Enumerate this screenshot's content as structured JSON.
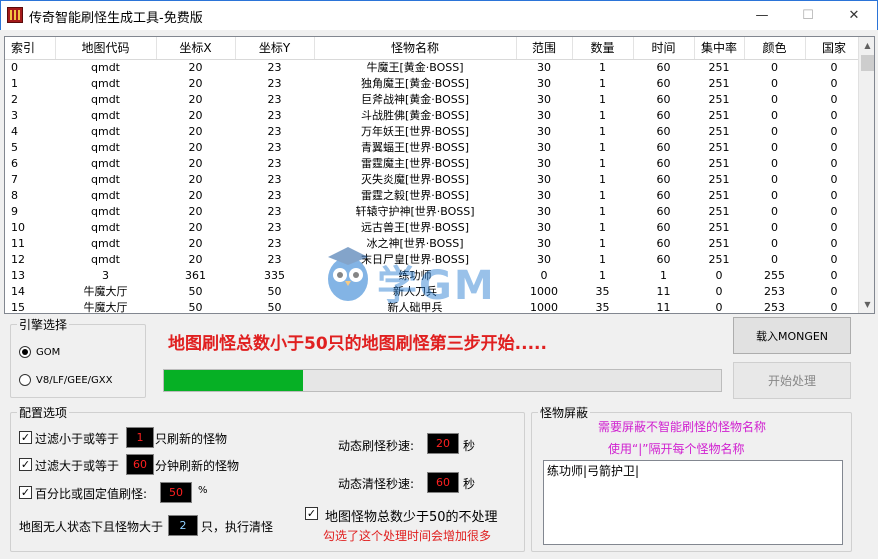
{
  "window": {
    "title": "传奇智能刷怪生成工具-免费版",
    "min": "—",
    "max": "☐",
    "close": "✕"
  },
  "grid": {
    "columns": [
      "索引",
      "地图代码",
      "坐标X",
      "坐标Y",
      "怪物名称",
      "范围",
      "数量",
      "时间",
      "集中率",
      "颜色",
      "国家"
    ],
    "rows": [
      [
        "0",
        "qmdt",
        "20",
        "23",
        "牛魔王[黄金·BOSS]",
        "30",
        "1",
        "60",
        "251",
        "0",
        "0"
      ],
      [
        "1",
        "qmdt",
        "20",
        "23",
        "独角魔王[黄金·BOSS]",
        "30",
        "1",
        "60",
        "251",
        "0",
        "0"
      ],
      [
        "2",
        "qmdt",
        "20",
        "23",
        "巨斧战神[黄金·BOSS]",
        "30",
        "1",
        "60",
        "251",
        "0",
        "0"
      ],
      [
        "3",
        "qmdt",
        "20",
        "23",
        "斗战胜佛[黄金·BOSS]",
        "30",
        "1",
        "60",
        "251",
        "0",
        "0"
      ],
      [
        "4",
        "qmdt",
        "20",
        "23",
        "万年妖王[世界·BOSS]",
        "30",
        "1",
        "60",
        "251",
        "0",
        "0"
      ],
      [
        "5",
        "qmdt",
        "20",
        "23",
        "青翼蝠王[世界·BOSS]",
        "30",
        "1",
        "60",
        "251",
        "0",
        "0"
      ],
      [
        "6",
        "qmdt",
        "20",
        "23",
        "雷霆魔主[世界·BOSS]",
        "30",
        "1",
        "60",
        "251",
        "0",
        "0"
      ],
      [
        "7",
        "qmdt",
        "20",
        "23",
        "灭失炎魔[世界·BOSS]",
        "30",
        "1",
        "60",
        "251",
        "0",
        "0"
      ],
      [
        "8",
        "qmdt",
        "20",
        "23",
        "雷霆之毅[世界·BOSS]",
        "30",
        "1",
        "60",
        "251",
        "0",
        "0"
      ],
      [
        "9",
        "qmdt",
        "20",
        "23",
        "轩辕守护神[世界·BOSS]",
        "30",
        "1",
        "60",
        "251",
        "0",
        "0"
      ],
      [
        "10",
        "qmdt",
        "20",
        "23",
        "远古兽王[世界·BOSS]",
        "30",
        "1",
        "60",
        "251",
        "0",
        "0"
      ],
      [
        "11",
        "qmdt",
        "20",
        "23",
        "冰之神[世界·BOSS]",
        "30",
        "1",
        "60",
        "251",
        "0",
        "0"
      ],
      [
        "12",
        "qmdt",
        "20",
        "23",
        "末日尸皇[世界·BOSS]",
        "30",
        "1",
        "60",
        "251",
        "0",
        "0"
      ],
      [
        "13",
        "3",
        "361",
        "335",
        "练功师",
        "0",
        "1",
        "1",
        "0",
        "255",
        "0"
      ],
      [
        "14",
        "牛魔大厅",
        "50",
        "50",
        "新人刀兵",
        "1000",
        "35",
        "11",
        "0",
        "253",
        "0"
      ],
      [
        "15",
        "牛魔大厅",
        "50",
        "50",
        "新人础甲兵",
        "1000",
        "35",
        "11",
        "0",
        "253",
        "0"
      ]
    ]
  },
  "engine": {
    "legend": "引擎选择",
    "options": [
      "GOM",
      "V8/LF/GEE/GXX"
    ],
    "selected": 0
  },
  "status_message": "地图刷怪总数小于50只的地图刷怪第三步开始.....",
  "progress": 0.25,
  "buttons": {
    "load": "载入MONGEN",
    "start": "开始处理"
  },
  "config": {
    "legend": "配置选项",
    "filter_less": {
      "pre": "过滤小于或等于",
      "value": "1",
      "post": "只刷新的怪物",
      "checked": true
    },
    "filter_more": {
      "pre": "过滤大于或等于",
      "value": "60",
      "post": "分钟刷新的怪物",
      "checked": true
    },
    "percent": {
      "pre": "百分比或固定值刷怪:",
      "value": "50",
      "post": "%",
      "checked": true
    },
    "clear": {
      "pre": "地图无人状态下且怪物大于",
      "value": "2",
      "post": "只，执行清怪"
    },
    "dyn_spawn": {
      "label": "动态刷怪秒速:",
      "value": "20",
      "unit": "秒"
    },
    "dyn_clear": {
      "label": "动态清怪秒速:",
      "value": "60",
      "unit": "秒"
    },
    "skip_small": {
      "label": "地图怪物总数少于50的不处理",
      "checked": true,
      "warning": "勾选了这个处理时间会增加很多"
    }
  },
  "shield": {
    "legend": "怪物屏蔽",
    "hint1": "需要屏蔽不智能刷怪的怪物名称",
    "hint2": "使用“|”隔开每个怪物名称",
    "value": "练功师|弓箭护卫|"
  },
  "watermark": "学GM",
  "colors": {
    "accent": "#2b74d8",
    "progress": "#06b025",
    "red": "#e02020",
    "magenta": "#d020d0"
  }
}
